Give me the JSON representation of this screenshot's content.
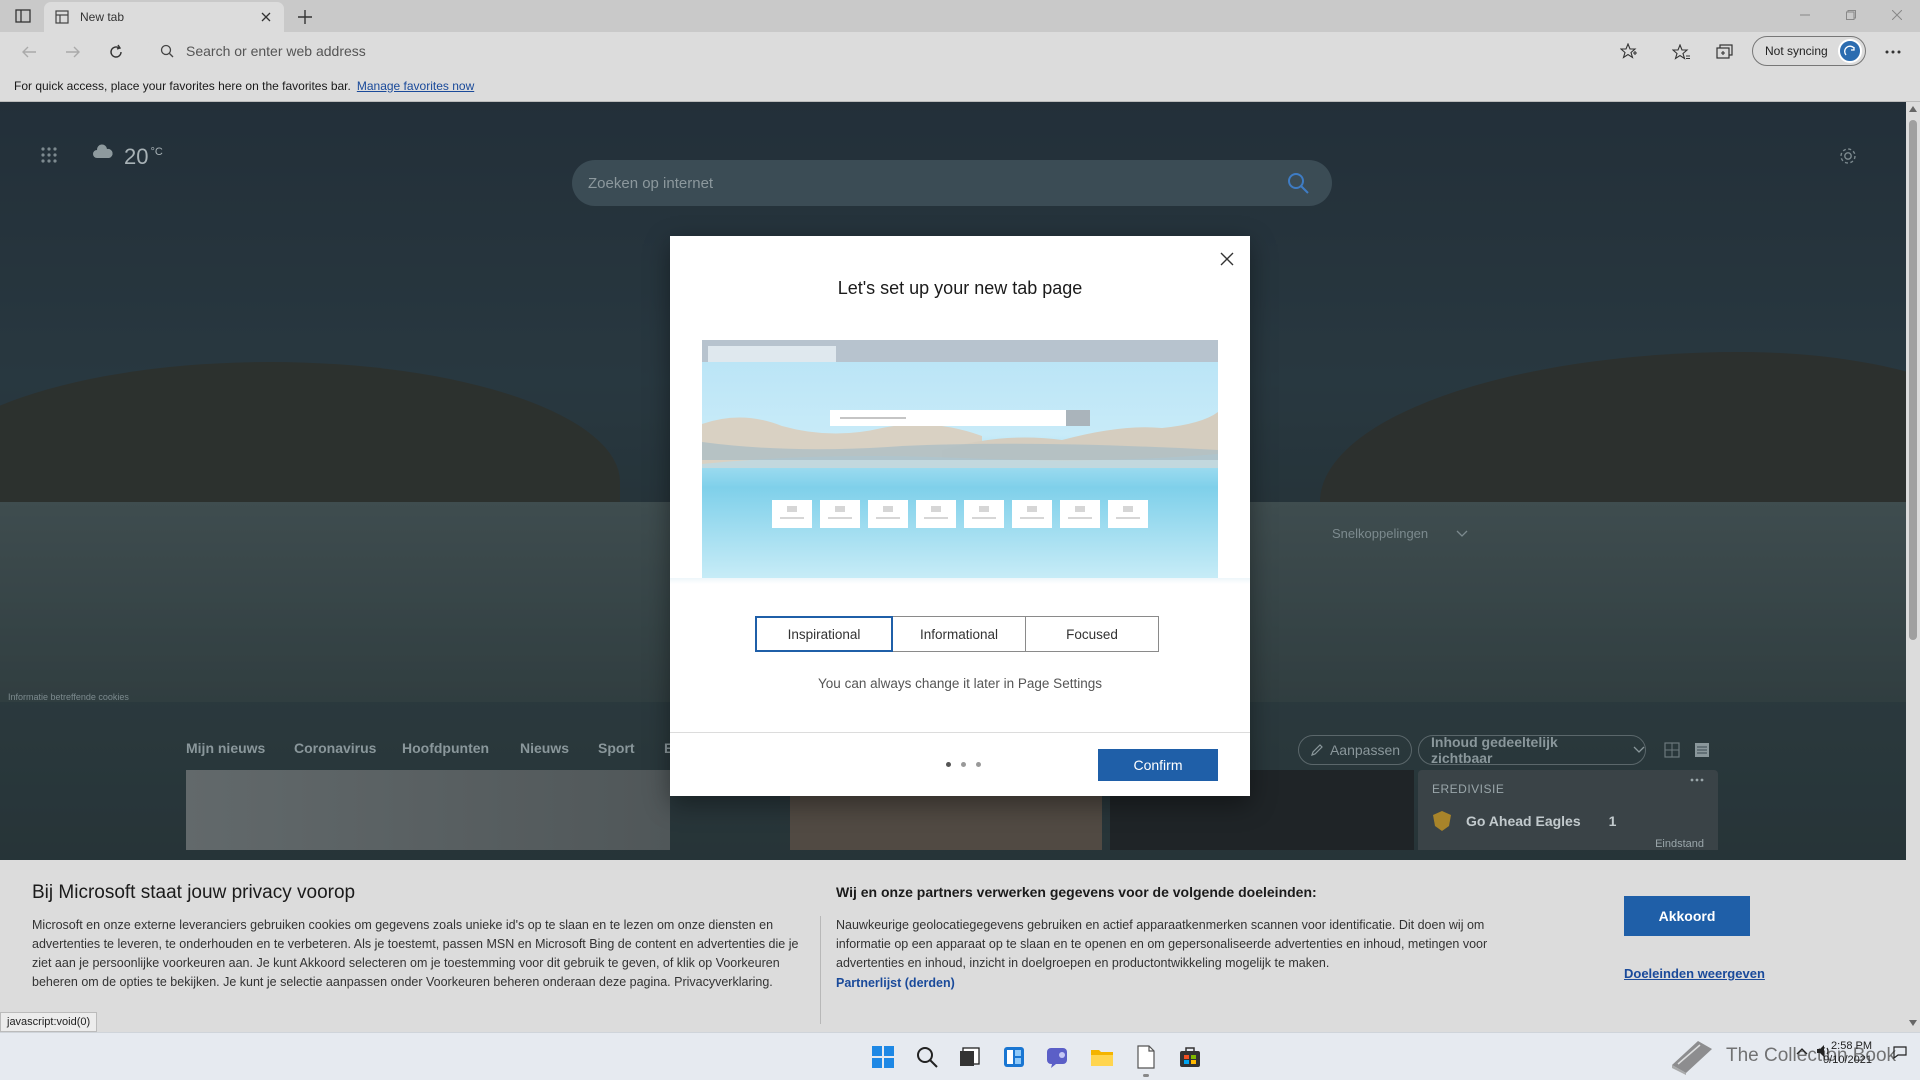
{
  "browser": {
    "tab_title": "New tab",
    "address_placeholder": "Search or enter web address",
    "sync_label": "Not syncing",
    "favbar_text": "For quick access, place your favorites here on the favorites bar.",
    "favbar_link": "Manage favorites now"
  },
  "newtab": {
    "weather_temp": "20",
    "weather_unit": "°C",
    "search_placeholder": "Zoeken op internet",
    "quicklinks_label": "Snelkoppelingen",
    "cookies_note": "Informatie betreffende cookies",
    "news_tabs": [
      "Mijn nieuws",
      "Coronavirus",
      "Hoofdpunten",
      "Nieuws",
      "Sport",
      "E"
    ],
    "customize_label": "Aanpassen",
    "visibility_label": "Inhoud gedeeltelijk zichtbaar",
    "eredivisie": {
      "title": "EREDIVISIE",
      "team": "Go Ahead Eagles",
      "score": "1",
      "status": "Eindstand"
    }
  },
  "modal": {
    "title": "Let's set up your new tab page",
    "options": [
      "Inspirational",
      "Informational",
      "Focused"
    ],
    "selected": "Inspirational",
    "note": "You can always change it later in Page Settings",
    "confirm_label": "Confirm",
    "pages": 3,
    "current_page": 1
  },
  "privacy": {
    "title": "Bij Microsoft staat jouw privacy voorop",
    "left_text": "Microsoft en onze externe leveranciers gebruiken cookies om gegevens zoals unieke id's op te slaan en te lezen om onze diensten en advertenties te leveren, te onderhouden en te verbeteren. Als je toestemt, passen MSN en Microsoft Bing de content en advertenties die je ziet aan je persoonlijke voorkeuren aan. Je kunt Akkoord selecteren om je toestemming voor dit gebruik te geven, of klik op Voorkeuren beheren om de opties te bekijken. Je kunt je selectie aanpassen onder Voorkeuren beheren onderaan deze pagina. Privacyverklaring.",
    "right_title": "Wij en onze partners verwerken gegevens voor de volgende doeleinden:",
    "right_text": "Nauwkeurige geolocatiegegevens gebruiken en actief apparaatkenmerken scannen voor identificatie. Dit doen wij om informatie op een apparaat op te slaan en te openen en om gepersonaliseerde advertenties en inhoud, metingen voor advertenties en inhoud, inzicht in doelgroepen en productontwikkeling mogelijk te maken.",
    "partner_link": "Partnerlijst (derden)",
    "accept_label": "Akkoord",
    "purposes_link": "Doeleinden weergeven"
  },
  "status_url": "javascript:void(0)",
  "taskbar": {
    "clock_time": "2:58 PM",
    "clock_date": "9/10/2021",
    "watermark": "The Collection Book"
  },
  "colors": {
    "accent": "#1f5fa8",
    "link": "#1a4a9a",
    "chrome": "#dcdcdc"
  }
}
